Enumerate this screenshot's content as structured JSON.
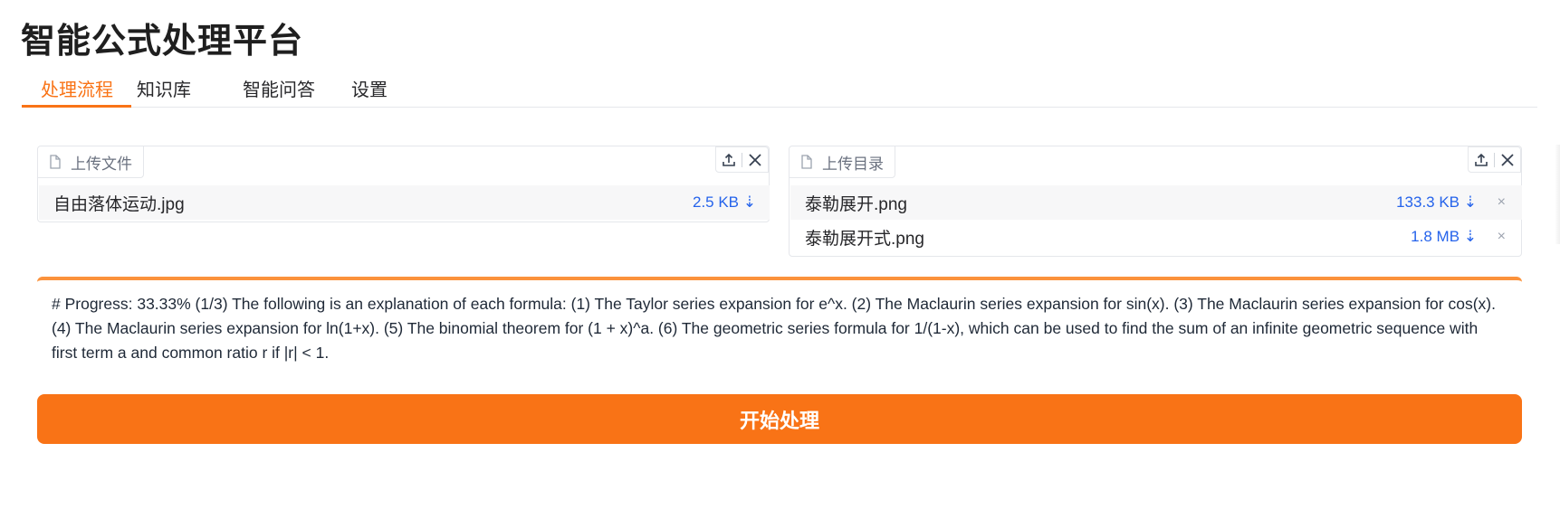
{
  "app": {
    "title": "智能公式处理平台"
  },
  "tabs": [
    {
      "label": "处理流程",
      "active": true
    },
    {
      "label": "知识库",
      "active": false
    },
    {
      "label": "智能问答",
      "active": false
    },
    {
      "label": "设置",
      "active": false
    }
  ],
  "upload_file": {
    "label": "上传文件",
    "files": [
      {
        "name": "自由落体运动.jpg",
        "size": "2.5 KB ⇣"
      }
    ]
  },
  "upload_dir": {
    "label": "上传目录",
    "files": [
      {
        "name": "泰勒展开.png",
        "size": "133.3 KB ⇣",
        "remove": "×"
      },
      {
        "name": "泰勒展开式.png",
        "size": "1.8 MB ⇣",
        "remove": "×"
      }
    ]
  },
  "output": {
    "text": "# Progress: 33.33% (1/3) The following is an explanation of each formula: (1) The Taylor series expansion for e^x. (2) The Maclaurin series expansion for sin(x). (3) The Maclaurin series expansion for cos(x). (4) The Maclaurin series expansion for ln(1+x). (5) The binomial theorem for (1 + x)^a. (6) The geometric series formula for 1/(1-x), which can be used to find the sum of an infinite geometric sequence with first term a and common ratio r if |r| < 1."
  },
  "actions": {
    "start_label": "开始处理"
  },
  "icons": {
    "file": "file-icon",
    "upload": "upload-icon",
    "clear": "close-icon",
    "remove": "remove-icon"
  },
  "colors": {
    "accent": "#f97316",
    "link": "#2563eb"
  }
}
